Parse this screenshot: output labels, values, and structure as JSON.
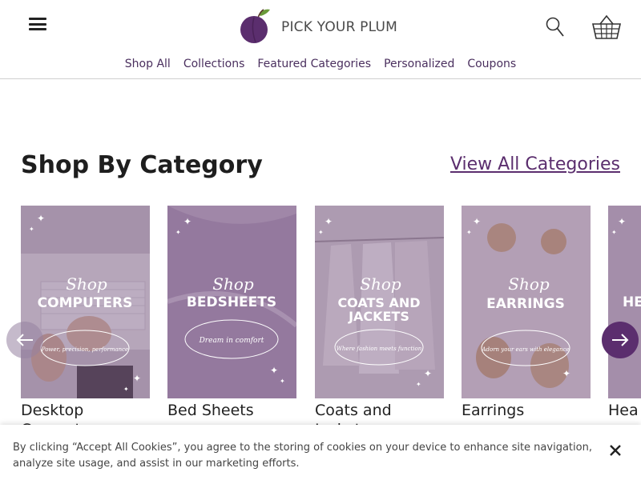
{
  "header": {
    "brand": "PICK YOUR PLUM",
    "menu_icon": "hamburger-menu-icon",
    "search_icon": "search-icon",
    "cart_icon": "basket-icon"
  },
  "nav": [
    {
      "label": "Shop All"
    },
    {
      "label": "Collections"
    },
    {
      "label": "Featured Categories"
    },
    {
      "label": "Personalized"
    },
    {
      "label": "Coupons"
    }
  ],
  "section": {
    "title": "Shop By Category",
    "view_all": "View All Categories"
  },
  "categories": [
    {
      "title": "Desktop Computers",
      "shop": "Shop",
      "heading": "COMPUTERS",
      "heading2": "",
      "tagline": "Power, precision, performance"
    },
    {
      "title": "Bed Sheets",
      "shop": "Shop",
      "heading": "BEDSHEETS",
      "heading2": "",
      "tagline": "Dream in comfort"
    },
    {
      "title": "Coats and Jackets",
      "shop": "Shop",
      "heading": "COATS AND",
      "heading2": "JACKETS",
      "tagline": "Where fashion meets function"
    },
    {
      "title": "Earrings",
      "shop": "Shop",
      "heading": "EARRINGS",
      "heading2": "",
      "tagline": "Adorn your ears with elegance"
    },
    {
      "title": "Hea",
      "shop": "",
      "heading": "HE",
      "heading2": "",
      "tagline": ""
    }
  ],
  "cookie": {
    "text": "By clicking “Accept All Cookies”, you agree to the storing of cookies on your device to enhance site navigation, analyze site usage, and assist in our marketing efforts.",
    "close_icon": "close-icon"
  },
  "colors": {
    "brand": "#5b2e6e",
    "card_overlay": "#8a6a93"
  }
}
